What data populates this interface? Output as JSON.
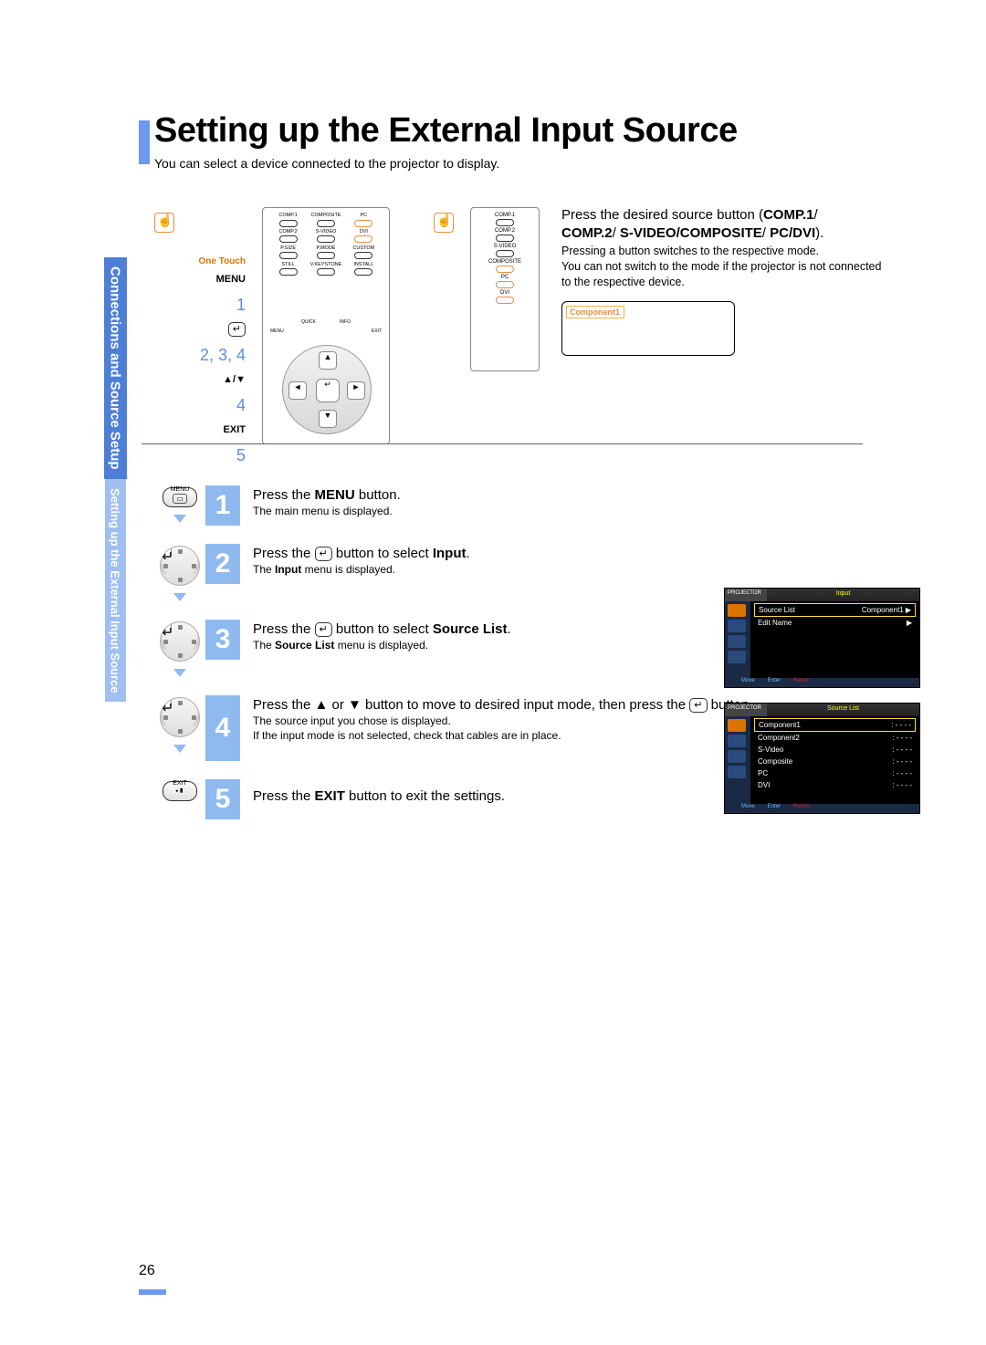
{
  "page_number": "26",
  "title": "Setting up the External Input Source",
  "subtitle": "You can select a device connected to the projector to display.",
  "side_tab": {
    "main": "Connections and Source Setup",
    "sub": "Setting up the External Input Source"
  },
  "remote_guide": {
    "one_touch": "One Touch",
    "menu": "MENU",
    "n1": "1",
    "enter": "↵",
    "n234": "2, 3, 4",
    "updown": "▲/▼",
    "n4": "4",
    "exit": "EXIT",
    "n5": "5"
  },
  "remote_buttons": {
    "r1": [
      "COMP.1",
      "COMPOSITE",
      "PC"
    ],
    "r2": [
      "COMP.2",
      "S-VIDEO",
      "DVI"
    ],
    "r3": [
      "P.SIZE",
      "P.MODE",
      "CUSTOM"
    ],
    "r4": [
      "STILL",
      "V.KEYSTONE",
      "INSTALL"
    ],
    "arc": [
      "MENU",
      "QUICK",
      "INFO",
      "EXIT"
    ]
  },
  "small_remote": [
    "COMP.1",
    "COMP.2",
    "S-VIDEO",
    "COMPOSITE",
    "PC",
    "DVI"
  ],
  "top_desc": {
    "line1a": "Press the desired source button (",
    "line1b": "COMP.1",
    "line1c": "/",
    "line2a": "COMP.2",
    "line2b": "/ ",
    "line2c": "S-VIDEO/COMPOSITE",
    "line2d": "/ ",
    "line2e": "PC/DVI",
    "line2f": ").",
    "sub1": "Pressing a button switches to the respective mode.",
    "sub2": "You can not switch to the mode if the projector is not connected to the respective device.",
    "component1": "Component1"
  },
  "steps": [
    {
      "icon_label_top": "MENU",
      "num": "1",
      "body_a": "Press the ",
      "body_b": "MENU",
      "body_c": " button.",
      "sub": "The main menu is displayed."
    },
    {
      "num": "2",
      "body_a": "Press the ",
      "body_enter": "↵",
      "body_b": " button to select ",
      "body_c": "Input",
      "body_d": ".",
      "sub_a": "The ",
      "sub_b": "Input",
      "sub_c": " menu is displayed."
    },
    {
      "num": "3",
      "body_a": "Press the ",
      "body_enter": "↵",
      "body_b": " button to select ",
      "body_c": "Source List",
      "body_d": ".",
      "sub_a": "The ",
      "sub_b": "Source List",
      "sub_c": " menu is displayed."
    },
    {
      "num": "4",
      "body_a": "Press the ▲ or ▼ button to move to desired input mode, then press the ",
      "body_enter": "↵",
      "body_b": " button.",
      "sub1": "The source input you chose is displayed.",
      "sub2": "If the input mode is not selected, check that cables are in place."
    },
    {
      "icon_label_top": "EXIT",
      "num": "5",
      "body_a": "Press the ",
      "body_b": "EXIT",
      "body_c": " button to exit the settings."
    }
  ],
  "menu_screens": {
    "projector_label": "PROJECTOR",
    "input_title": "Input",
    "source_list_title": "Source List",
    "input_rows": [
      {
        "k": "Source List",
        "v": "Component1 ▶"
      },
      {
        "k": "Edit Name",
        "v": "▶"
      }
    ],
    "source_rows": [
      {
        "k": "Component1",
        "v": ": - - - -"
      },
      {
        "k": "Component2",
        "v": ": - - - -"
      },
      {
        "k": "S-Video",
        "v": ": - - - -"
      },
      {
        "k": "Composite",
        "v": ": - - - -"
      },
      {
        "k": "PC",
        "v": ": - - - -"
      },
      {
        "k": "DVI",
        "v": ": - - - -"
      }
    ],
    "footer": [
      "Move",
      "Enter",
      "Return"
    ]
  }
}
